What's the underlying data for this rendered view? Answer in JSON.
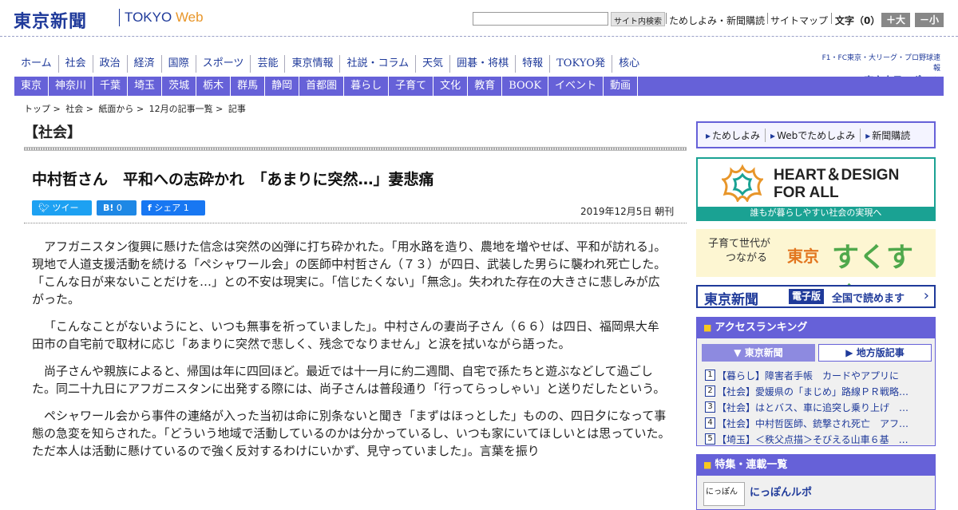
{
  "header": {
    "logo": "東京新聞",
    "logo_sub_left": "TOKYO ",
    "logo_sub_right": "Web",
    "search_button": "サイト内検索",
    "utility_links": [
      "ためしよみ・新聞購読",
      "サイトマップ"
    ],
    "font_size_label": "文字（0）",
    "font_larger": "＋大",
    "font_smaller": "－小"
  },
  "global_nav": [
    "ホーム",
    "社会",
    "政治",
    "経済",
    "国際",
    "スポーツ",
    "芸能",
    "東京情報",
    "社説・コラム",
    "天気",
    "囲碁・将棋",
    "特報",
    "TOKYO発",
    "核心"
  ],
  "sports_banner": {
    "line1": "F1・FC東京・大リーグ・プロ野球速報",
    "line2": "東京中日スポーツ"
  },
  "local_nav": [
    "東京",
    "神奈川",
    "千葉",
    "埼玉",
    "茨城",
    "栃木",
    "群馬",
    "静岡",
    "首都圏",
    "暮らし",
    "子育て",
    "文化",
    "教育",
    "BOOK",
    "イベント",
    "動画"
  ],
  "breadcrumb": [
    "トップ",
    "社会",
    "紙面から",
    "12月の記事一覧",
    "記事"
  ],
  "breadcrumb_sep": ">",
  "section": "【社会】",
  "article": {
    "headline": "中村哲さん　平和への志砕かれ　「あまりに突然…」妻悲痛",
    "share": {
      "tweet": "ツイート",
      "hatena_label": "B!",
      "hatena_count": "0",
      "facebook_label": "シェア",
      "facebook_count": "1"
    },
    "date": "2019年12月5日 朝刊",
    "paragraphs": [
      "アフガニスタン復興に懸けた信念は突然の凶弾に打ち砕かれた。「用水路を造り、農地を増やせば、平和が訪れる」。現地で人道支援活動を続ける「ペシャワール会」の医師中村哲さん（７３）が四日、武装した男らに襲われ死亡した。「こんな日が来ないことだけを…」との不安は現実に。「信じたくない」「無念」。失われた存在の大きさに悲しみが広がった。",
      "「こんなことがないようにと、いつも無事を祈っていました」。中村さんの妻尚子さん（６６）は四日、福岡県大牟田市の自宅前で取材に応じ「あまりに突然で悲しく、残念でなりません」と涙を拭いながら語った。",
      "尚子さんや親族によると、帰国は年に四回ほど。最近では十一月に約二週間、自宅で孫たちと遊ぶなどして過ごした。同二十九日にアフガニスタンに出発する際には、尚子さんは普段通り「行ってらっしゃい」と送りだしたという。",
      "ペシャワール会から事件の連絡が入った当初は命に別条ないと聞き「まずはほっとした」ものの、四日夕になって事態の急変を知らされた。「どういう地域で活動しているのかは分かっているし、いつも家にいてほしいとは思っていた。ただ本人は活動に懸けているので強く反対するわけにいかず、見守っていました」。言葉を振り"
    ]
  },
  "sidebar": {
    "try_links": [
      "ためしよみ",
      "Webでためしよみ",
      "新聞購読"
    ],
    "heart_design": {
      "title_line1": "HEART＆DESIGN",
      "title_line2": "FOR ALL",
      "subtitle": "誰もが暮らしやすい社会の実現へ"
    },
    "sukusuku": {
      "line1": "子育て世代が",
      "line2": "つながる",
      "city": "東京",
      "name": "すくすく"
    },
    "e_paper": {
      "logo": "東京新聞",
      "tag": "電子版",
      "text": "全国で読めます",
      "arrow": "›"
    },
    "ranking": {
      "heading": "アクセスランキング",
      "tab_active": "東京新聞",
      "tab_other": "地方版記事",
      "items": [
        {
          "num": "1",
          "text": "【暮らし】障害者手帳　カードやアプリに"
        },
        {
          "num": "2",
          "text": "【社会】愛媛県の「まじめ」路線ＰＲ戦略…"
        },
        {
          "num": "3",
          "text": "【社会】はとバス、車に追突し乗り上げ　…"
        },
        {
          "num": "4",
          "text": "【社会】中村哲医師、銃撃され死亡　アフ…"
        },
        {
          "num": "5",
          "text": "【埼玉】＜秩父点描＞そびえる山車６基　…"
        }
      ]
    },
    "features": {
      "heading": "特集・連載一覧",
      "thumb": "にっぽん",
      "title": "にっぽんルポ"
    }
  },
  "colors": {
    "brand": "#1f3a9a",
    "nav": "#6661d8",
    "accent": "#e8962a",
    "teal": "#1aa293"
  }
}
